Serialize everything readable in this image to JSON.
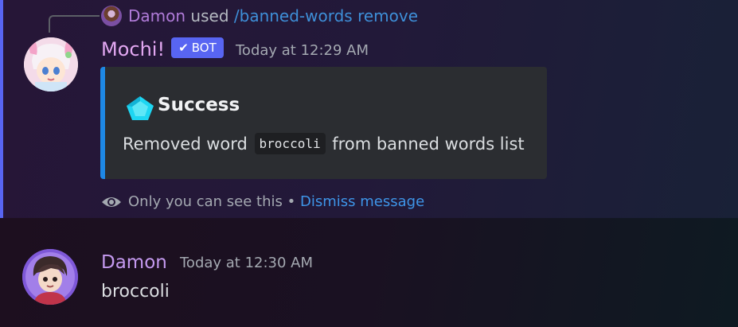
{
  "reply": {
    "user": "Damon",
    "used": "used",
    "command": "/banned-words remove"
  },
  "bot_message": {
    "author": "Mochi!",
    "badge": "BOT",
    "timestamp": "Today at 12:29 AM",
    "embed": {
      "title": "Success",
      "description_before": "Removed word",
      "code": "broccoli",
      "description_after": "from banned words list",
      "accent_color": "#1e88e5"
    },
    "ephemeral_notice": "Only you can see this",
    "separator": "•",
    "dismiss_label": "Dismiss message"
  },
  "user_message": {
    "author": "Damon",
    "timestamp": "Today at 12:30 AM",
    "content": "broccoli"
  },
  "colors": {
    "blurple": "#5865f2",
    "link": "#3e95e8",
    "embed_bg": "#2b2d31"
  },
  "icons": {
    "badge": "checkmark-icon",
    "embed": "star-gem-icon",
    "notice": "eye-icon"
  }
}
